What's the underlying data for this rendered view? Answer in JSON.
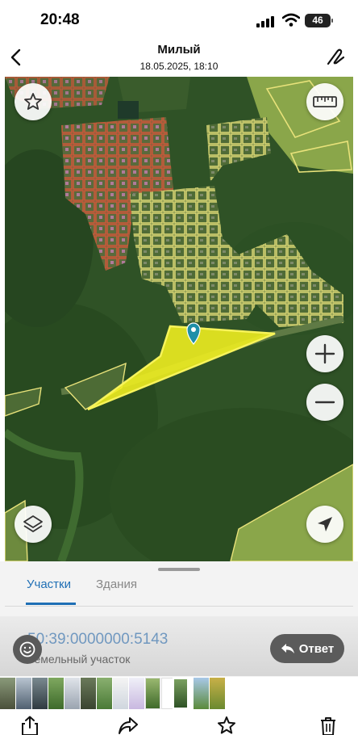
{
  "status_bar": {
    "time": "20:48",
    "battery": "46"
  },
  "header": {
    "title": "Милый",
    "subtitle": "18.05.2025, 18:10"
  },
  "map": {
    "favorite_icon": "star-icon",
    "ruler_icon": "ruler-icon",
    "zoom_in_icon": "plus-icon",
    "zoom_out_icon": "minus-icon",
    "layers_icon": "layers-icon",
    "locate_icon": "location-arrow-icon",
    "selected_parcel_color": "#f2f020",
    "parcel_outline_color": "#e8e27a",
    "neighbor_outline_color": "#d8563a"
  },
  "tabs": [
    {
      "label": "Участки",
      "active": true
    },
    {
      "label": "Здания",
      "active": false
    }
  ],
  "parcel": {
    "number": "50:39:0000000:5143",
    "type": "Земельный участок"
  },
  "reply": {
    "label": "Ответ"
  },
  "toolbar": {
    "icons": [
      "share-icon",
      "forward-icon",
      "star-icon",
      "trash-icon"
    ]
  }
}
